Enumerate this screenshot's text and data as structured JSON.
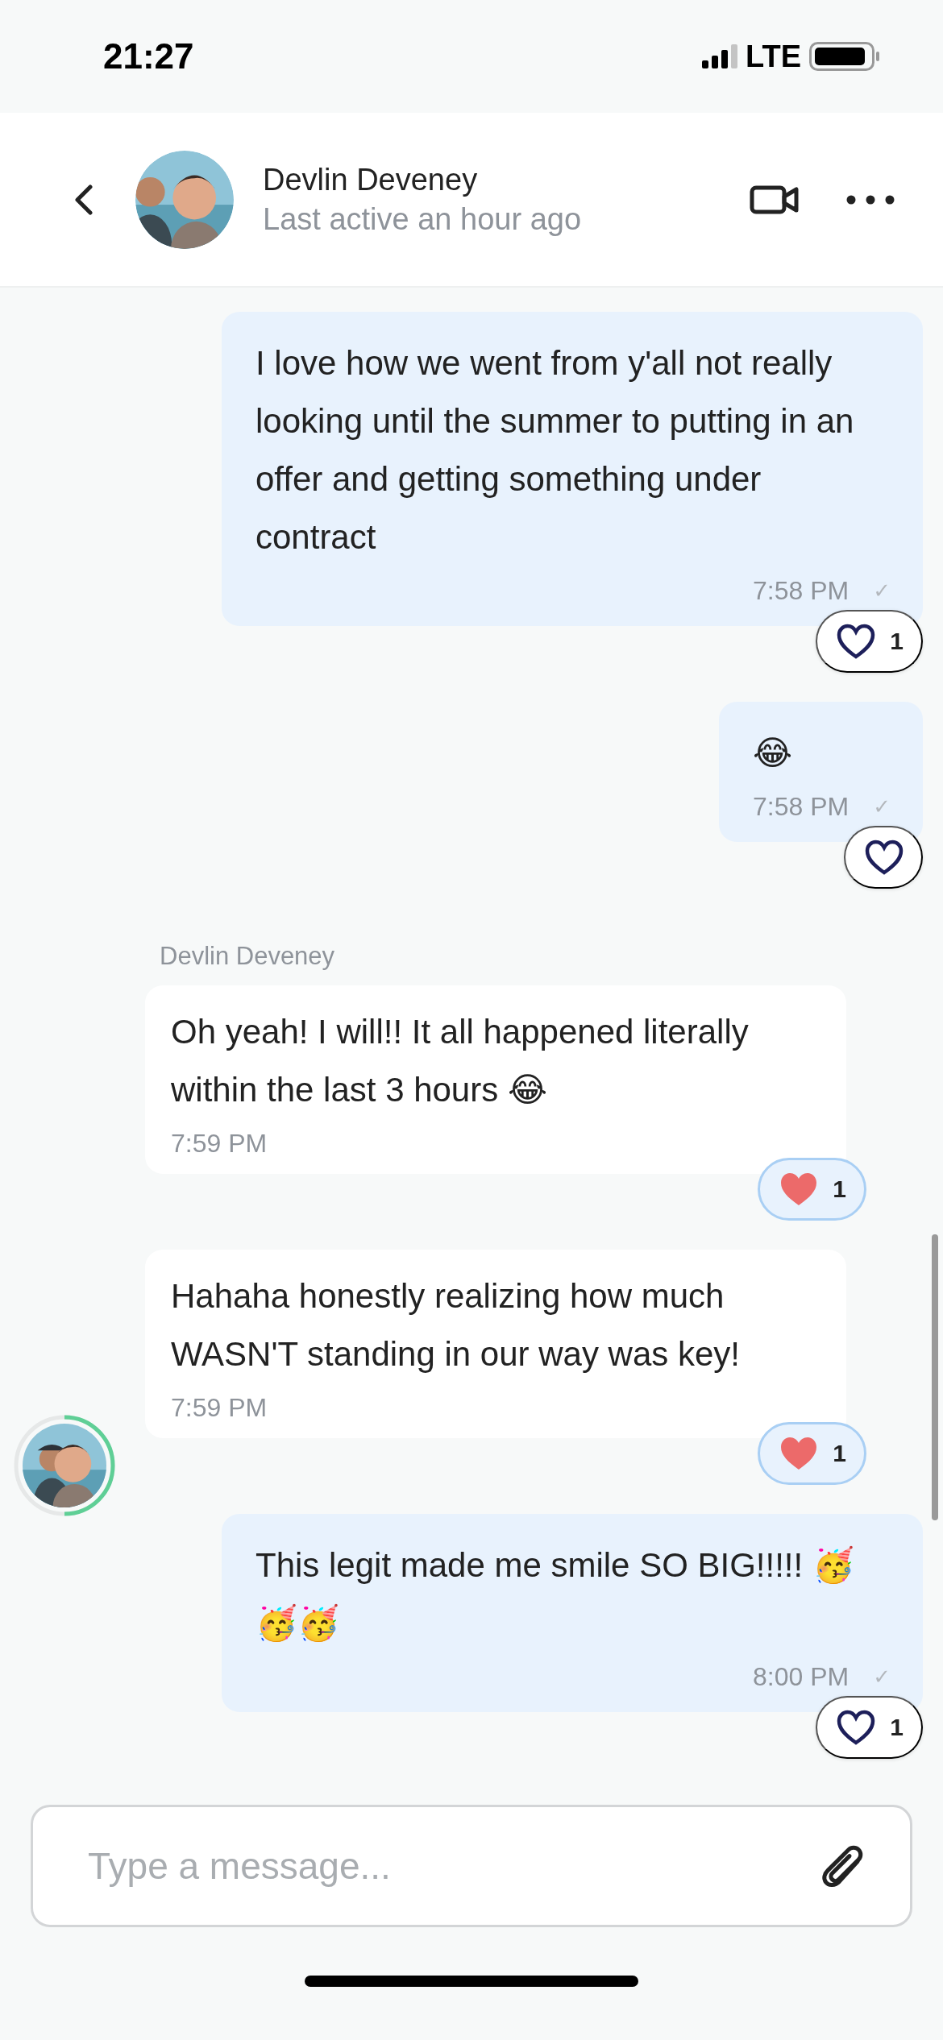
{
  "status_bar": {
    "time": "21:27",
    "network": "LTE"
  },
  "header": {
    "name": "Devlin Deveney",
    "subtitle": "Last active an hour ago"
  },
  "messages": [
    {
      "kind": "outgoing",
      "text": "I love how we went from y'all not really looking until the summer to putting in an offer and getting something under contract",
      "time": "7:58 PM",
      "check": "✓",
      "reaction": {
        "reacted": false,
        "count": "1"
      }
    },
    {
      "kind": "outgoing",
      "text": "😂",
      "time": "7:58 PM",
      "check": "✓",
      "reaction": {
        "reacted": false
      }
    },
    {
      "kind": "incoming",
      "sender": "Devlin Deveney",
      "text": "Oh yeah! I will!! It all happened literally within the last 3 hours 😂",
      "time": "7:59 PM",
      "reaction": {
        "reacted": true,
        "count": "1"
      }
    },
    {
      "kind": "incoming",
      "text": "Hahaha honestly realizing how much WASN'T standing in our way was key!",
      "time": "7:59 PM",
      "avatar": true,
      "reaction": {
        "reacted": true,
        "count": "1"
      }
    },
    {
      "kind": "outgoing",
      "text": "This legit made me smile SO BIG!!!!!  🥳🥳🥳",
      "time": "8:00 PM",
      "check": "✓",
      "reaction": {
        "reacted": false,
        "count": "1"
      }
    }
  ],
  "composer": {
    "placeholder": "Type a message..."
  }
}
